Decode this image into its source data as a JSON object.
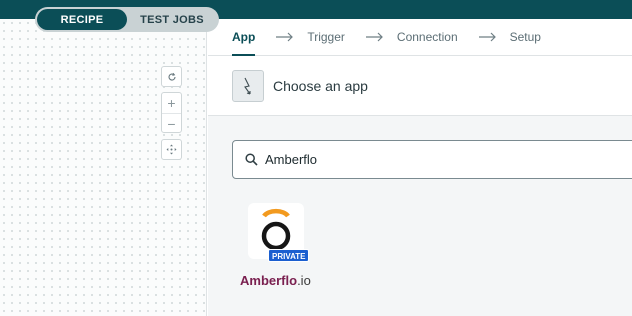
{
  "mode_toggle": {
    "recipe": "RECIPE",
    "test_jobs": "TEST JOBS",
    "active": "recipe"
  },
  "canvas_tools": {
    "reset": "reset-icon",
    "zoom_in": "+",
    "zoom_out": "−",
    "fit": "fit-view-icon"
  },
  "steps": [
    {
      "label": "App",
      "active": true
    },
    {
      "label": "Trigger",
      "active": false
    },
    {
      "label": "Connection",
      "active": false
    },
    {
      "label": "Setup",
      "active": false
    }
  ],
  "app_header": {
    "text": "Choose an app",
    "icon": "lightning-icon"
  },
  "search": {
    "value": "Amberflo",
    "icon": "search-icon"
  },
  "result": {
    "name_main": "Amberflo",
    "name_ext": ".io",
    "badge": "PRIVATE"
  },
  "colors": {
    "brand": "#0b4e57",
    "badge": "#1b5fd0",
    "result_name": "#7a2050",
    "logo_orange": "#f29a1f"
  }
}
